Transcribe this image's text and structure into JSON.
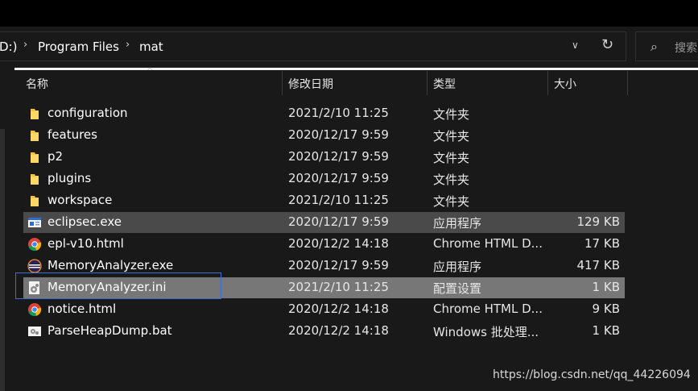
{
  "breadcrumb": {
    "drive": "D:)",
    "folder": "Program Files",
    "current": "mat"
  },
  "search": {
    "placeholder": "搜索"
  },
  "columns": {
    "name": "名称",
    "date": "修改日期",
    "type": "类型",
    "size": "大小"
  },
  "files": [
    {
      "name": "configuration",
      "date": "2021/2/10 11:25",
      "type": "文件夹",
      "size": "",
      "icon": "folder-icon"
    },
    {
      "name": "features",
      "date": "2020/12/17 9:59",
      "type": "文件夹",
      "size": "",
      "icon": "folder-icon"
    },
    {
      "name": "p2",
      "date": "2020/12/17 9:59",
      "type": "文件夹",
      "size": "",
      "icon": "folder-icon"
    },
    {
      "name": "plugins",
      "date": "2020/12/17 9:59",
      "type": "文件夹",
      "size": "",
      "icon": "folder-icon"
    },
    {
      "name": "workspace",
      "date": "2021/2/10 11:25",
      "type": "文件夹",
      "size": "",
      "icon": "folder-icon"
    },
    {
      "name": "eclipsec.exe",
      "date": "2020/12/17 9:59",
      "type": "应用程序",
      "size": "129 KB",
      "icon": "console-exe-icon"
    },
    {
      "name": "epl-v10.html",
      "date": "2020/12/2 14:18",
      "type": "Chrome HTML D...",
      "size": "17 KB",
      "icon": "chrome-icon"
    },
    {
      "name": "MemoryAnalyzer.exe",
      "date": "2020/12/17 9:59",
      "type": "应用程序",
      "size": "417 KB",
      "icon": "eclipse-icon"
    },
    {
      "name": "MemoryAnalyzer.ini",
      "date": "2021/2/10 11:25",
      "type": "配置设置",
      "size": "1 KB",
      "icon": "settings-file-icon"
    },
    {
      "name": "notice.html",
      "date": "2020/12/2 14:18",
      "type": "Chrome HTML D...",
      "size": "9 KB",
      "icon": "chrome-icon"
    },
    {
      "name": "ParseHeapDump.bat",
      "date": "2020/12/2 14:18",
      "type": "Windows 批处理...",
      "size": "1 KB",
      "icon": "batch-file-icon"
    }
  ],
  "watermark": "https://blog.csdn.net/qq_44226094",
  "colors": {
    "background": "#191919",
    "hover_row": "#4a4a4a",
    "selected_row": "#777777",
    "focus_border": "#3b6fd6"
  }
}
